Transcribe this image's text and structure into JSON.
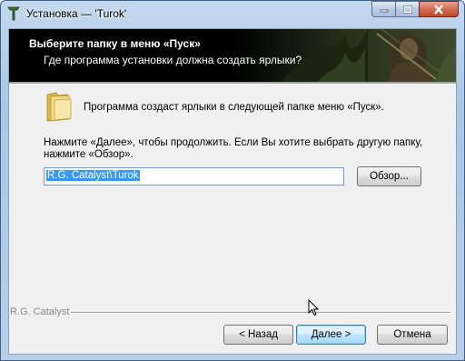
{
  "window": {
    "title": "Установка — 'Turok'",
    "icons": {
      "app": "turok-logo-icon",
      "minimize": "minimize-icon",
      "maximize": "maximize-icon",
      "close": "close-icon"
    }
  },
  "header": {
    "title": "Выберите папку в меню «Пуск»",
    "subtitle": "Где программа установки должна создать ярлыки?"
  },
  "body": {
    "folder_icon": "folder-icon",
    "info_text": "Программа создаст ярлыки в следующей папке меню «Пуск».",
    "instruction_text": "Нажмите «Далее», чтобы продолжить. Если Вы хотите выбрать другую папку, нажмите «Обзор».",
    "folder_path": "R.G. Catalyst\\Turok",
    "browse_label": "Обзор..."
  },
  "footer": {
    "brand": "R.G. Catalyst",
    "back_label": "< Назад",
    "next_label": "Далее >",
    "cancel_label": "Отмена"
  },
  "colors": {
    "selection": "#3399ff",
    "close_button": "#c2462a",
    "header_bg": "#000000"
  }
}
